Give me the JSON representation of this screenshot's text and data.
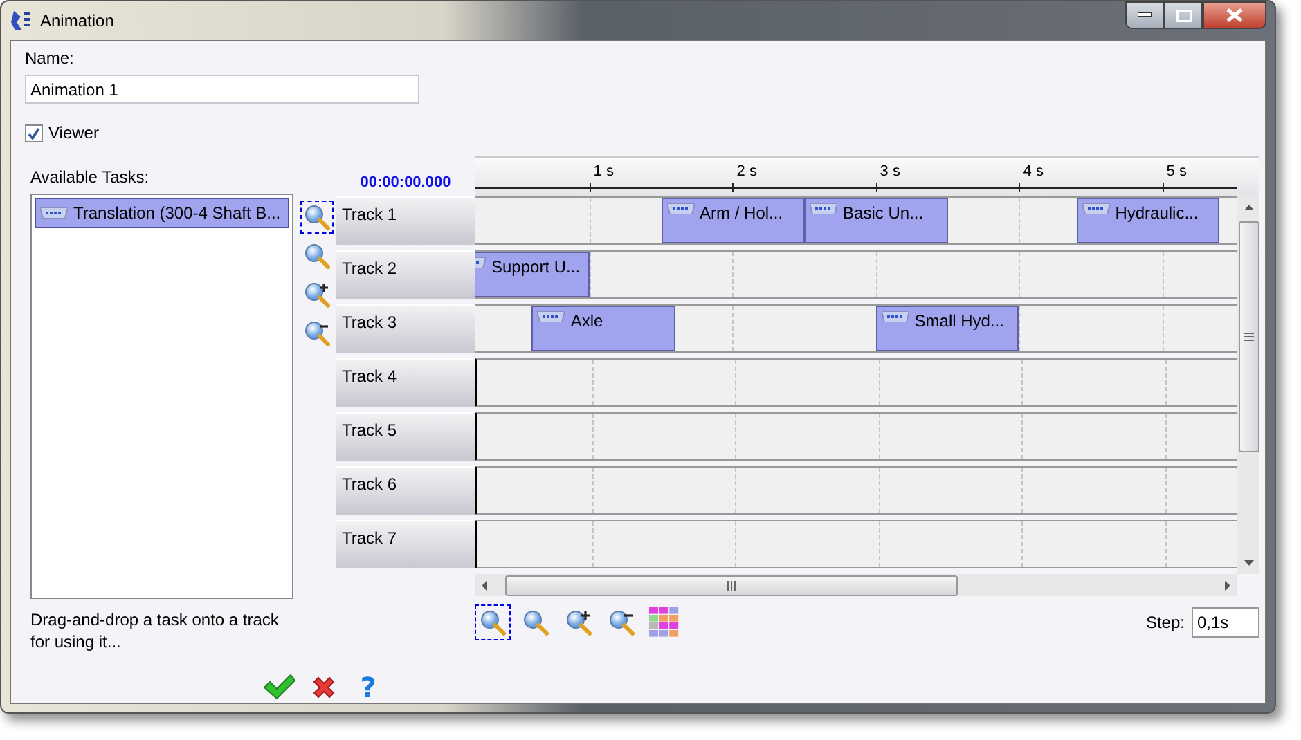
{
  "window": {
    "title": "Animation"
  },
  "name_field": {
    "label": "Name:",
    "value": "Animation 1"
  },
  "viewer": {
    "label": "Viewer",
    "checked": true
  },
  "tasks": {
    "label": "Available Tasks:",
    "items": [
      {
        "label": "Translation (300-4 Shaft B...",
        "selected": true
      }
    ],
    "hint": "Drag-and-drop a task onto a track for using it..."
  },
  "side_zoom": [
    {
      "kind": "fit",
      "selected": true
    },
    {
      "kind": "zoom",
      "selected": false
    },
    {
      "kind": "zoom_in",
      "selected": false
    },
    {
      "kind": "zoom_out",
      "selected": false
    }
  ],
  "timeline": {
    "time": "00:00:00.000",
    "ticks": [
      "1 s",
      "2 s",
      "3 s",
      "4 s",
      "5 s"
    ],
    "tracks": [
      {
        "label": "Track 1",
        "clips": [
          {
            "label": "Arm / Hol..."
          },
          {
            "label": "Basic Un..."
          },
          {
            "label": "Hydraulic..."
          }
        ]
      },
      {
        "label": "Track 2",
        "clips": [
          {
            "label": "Support U..."
          }
        ]
      },
      {
        "label": "Track 3",
        "clips": [
          {
            "label": "Axle"
          },
          {
            "label": "Small Hyd..."
          }
        ]
      },
      {
        "label": "Track 4"
      },
      {
        "label": "Track 5"
      },
      {
        "label": "Track 6"
      },
      {
        "label": "Track 7"
      }
    ]
  },
  "bottom_tools": [
    {
      "kind": "fit",
      "selected": true
    },
    {
      "kind": "zoom",
      "selected": false
    },
    {
      "kind": "zoom_in",
      "selected": false
    },
    {
      "kind": "zoom_out",
      "selected": false
    },
    {
      "kind": "grid",
      "selected": false
    }
  ],
  "step": {
    "label": "Step:",
    "value": "0,1s"
  },
  "actions": [
    {
      "kind": "ok"
    },
    {
      "kind": "cancel"
    },
    {
      "kind": "help",
      "label": "?"
    }
  ]
}
